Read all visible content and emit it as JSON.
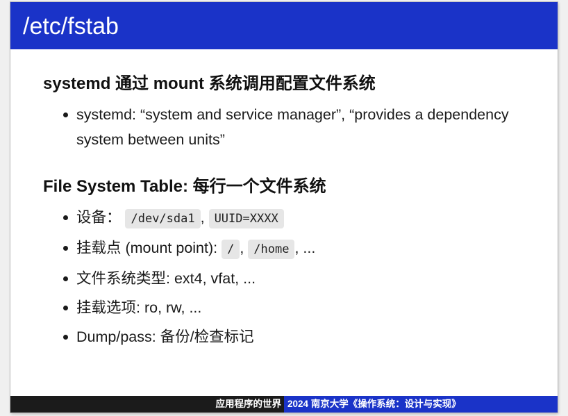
{
  "title": "/etc/fstab",
  "sections": [
    {
      "heading": "systemd 通过 mount 系统调用配置文件系统",
      "items": [
        {
          "text": "systemd: “system and service manager”, “provides a dependency system between units”"
        }
      ]
    },
    {
      "heading": "File System Table: 每行一个文件系统",
      "items": [
        {
          "prefix": "设备： ",
          "code1": "/dev/sda1",
          "sep": ", ",
          "code2": "UUID=XXXX",
          "suffix": ""
        },
        {
          "prefix": "挂载点 (mount point): ",
          "code1": "/",
          "sep": ", ",
          "code2": "/home",
          "suffix": ", ..."
        },
        {
          "text": "文件系统类型: ext4, vfat, ..."
        },
        {
          "text": "挂载选项: ro, rw, ..."
        },
        {
          "text": "Dump/pass: 备份/检查标记"
        }
      ]
    }
  ],
  "footer": {
    "left": "应用程序的世界",
    "right": "2024 南京大学《操作系统：设计与实现》"
  },
  "colors": {
    "accent": "#1a33c8",
    "footer_dark": "#1b1b1b",
    "code_bg": "#e6e6e6"
  }
}
